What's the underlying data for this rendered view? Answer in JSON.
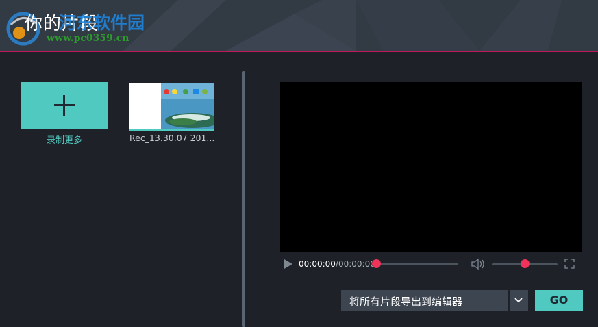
{
  "header": {
    "title": "你的片段",
    "watermark_name": "河东软件园",
    "watermark_url": "www.pc0359.cn"
  },
  "clips_panel": {
    "record_more_label": "录制更多",
    "clips": [
      {
        "label": "Rec_13.30.07 201..."
      }
    ]
  },
  "player": {
    "current_time": "00:00:00",
    "separator": "/",
    "total_time": "00:00:00",
    "progress_fraction": 0.0,
    "volume_fraction": 0.5
  },
  "export": {
    "selected_option": "将所有片段导出到编辑器",
    "go_label": "GO"
  },
  "colors": {
    "accent": "#50c9c0",
    "slider_knob": "#f0335a",
    "header_underline": "#c2185b"
  },
  "icons": [
    "plus-icon",
    "play-icon",
    "volume-icon",
    "fullscreen-icon",
    "chevron-down-icon"
  ]
}
